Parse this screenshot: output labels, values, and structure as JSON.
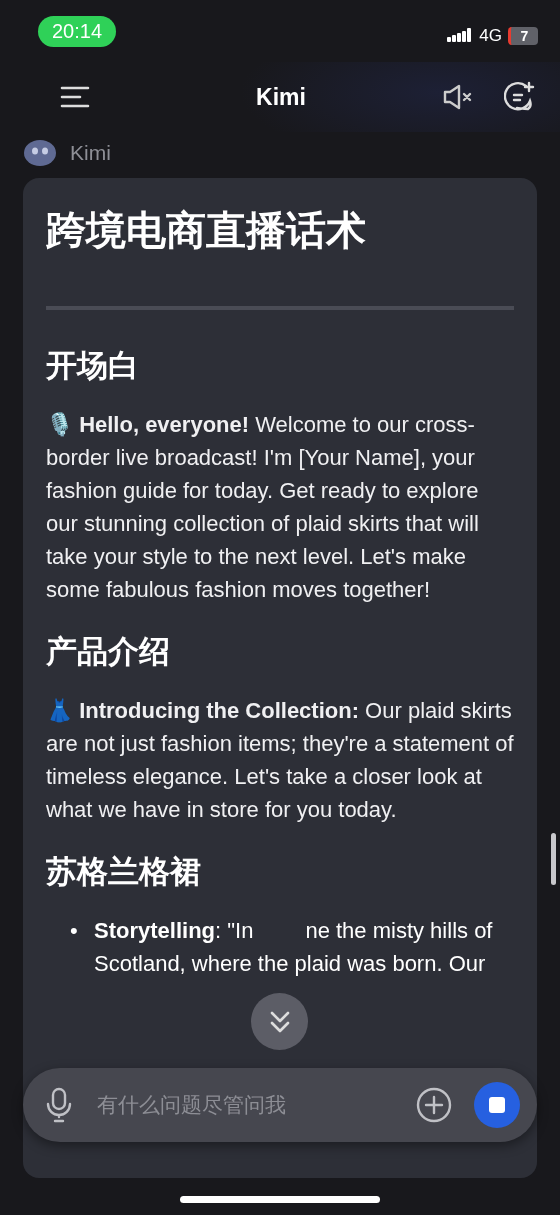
{
  "status_bar": {
    "time": "20:14",
    "network": "4G",
    "battery": "7"
  },
  "header": {
    "title": "Kimi"
  },
  "sender": {
    "name": "Kimi"
  },
  "message": {
    "title": "跨境电商直播话术",
    "sections": [
      {
        "heading": "开场白",
        "kind": "paragraph",
        "text": "🎙️ **Hello, everyone!** Welcome to our cross-border live broadcast! I'm [Your Name], your fashion guide for today. Get ready to explore our stunning collection of plaid skirts that will take your style to the next level. Let's make some fabulous fashion moves together!"
      },
      {
        "heading": "产品介绍",
        "kind": "paragraph",
        "text": "👗 **Introducing the Collection:** Our plaid skirts are not just fashion items; they're a statement of timeless elegance. Let's take a closer look at what we have in store for you today."
      },
      {
        "heading": "苏格兰格裙",
        "kind": "bullets",
        "bullets": [
          {
            "marker": "•",
            "before": "**Storytelling**: \"In",
            "after": "ne the misty hills of",
            "next_line": "Scotland, where the plaid was born. Our"
          }
        ]
      }
    ]
  },
  "composer": {
    "placeholder": "有什么问题尽管问我"
  }
}
